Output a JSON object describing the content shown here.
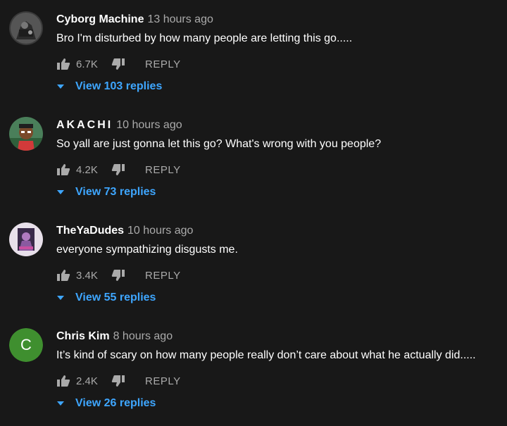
{
  "colors": {
    "background": "#181818",
    "link": "#3ea6ff",
    "muted": "#aaaaaa",
    "avatar_c": "#3f8f2f"
  },
  "comments": [
    {
      "author": "Cyborg Machine",
      "time": "13 hours ago",
      "text": "Bro I'm disturbed by how many people are letting this go.....",
      "likes": "6.7K",
      "reply_label": "REPLY",
      "replies_label": "View 103 replies",
      "avatar_icon": "robot-avatar-icon"
    },
    {
      "author": "AKACHI",
      "time": "10 hours ago",
      "text": "So yall are just gonna let this go? What's wrong with you people?",
      "likes": "4.2K",
      "reply_label": "REPLY",
      "replies_label": "View 73 replies",
      "avatar_icon": "cartoon-character-avatar-icon"
    },
    {
      "author": "TheYaDudes",
      "time": "10 hours ago",
      "text": "everyone sympathizing disgusts me.",
      "likes": "3.4K",
      "reply_label": "REPLY",
      "replies_label": "View 55 replies",
      "avatar_icon": "poster-avatar-icon"
    },
    {
      "author": "Chris Kim",
      "time": "8 hours ago",
      "text": "It’s kind of scary on how many people really don’t care about what he actually did.....",
      "likes": "2.4K",
      "reply_label": "REPLY",
      "replies_label": "View 26 replies",
      "avatar_letter": "C"
    }
  ]
}
